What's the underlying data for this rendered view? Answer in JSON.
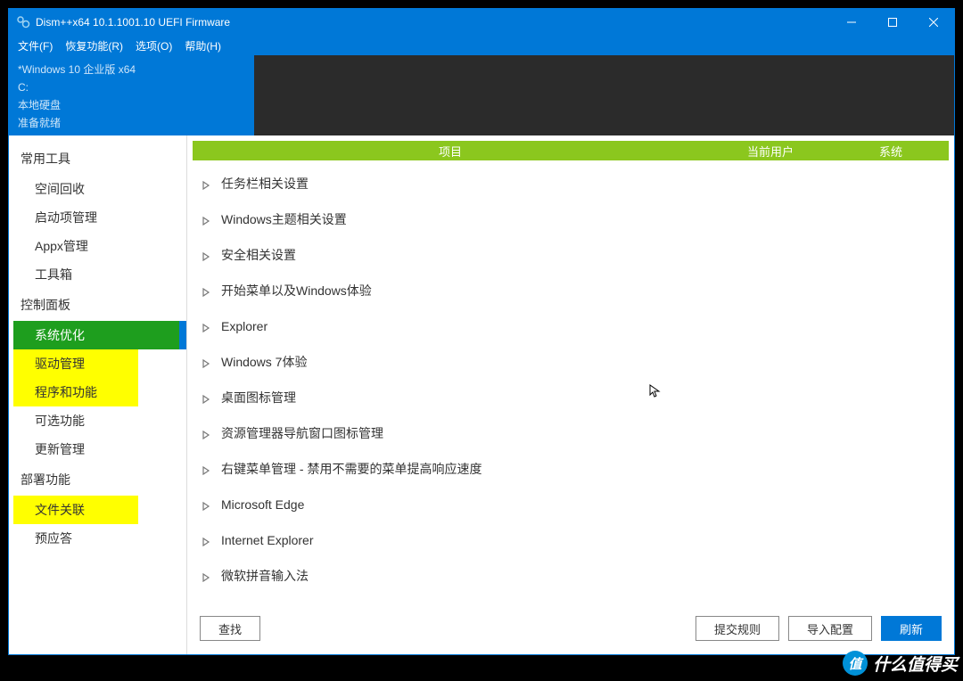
{
  "title": "Dism++x64 10.1.1001.10 UEFI Firmware",
  "menu": [
    "文件(F)",
    "恢复功能(R)",
    "选项(O)",
    "帮助(H)"
  ],
  "info": {
    "line1": "*Windows 10 企业版 x64",
    "line2": "C:",
    "line3": "本地硬盘",
    "line4": "准备就绪"
  },
  "sidebar": {
    "groups": [
      {
        "header": "常用工具",
        "items": [
          {
            "label": "空间回收"
          },
          {
            "label": "启动项管理"
          },
          {
            "label": "Appx管理"
          },
          {
            "label": "工具箱"
          }
        ]
      },
      {
        "header": "控制面板",
        "items": [
          {
            "label": "系统优化",
            "selected": true
          },
          {
            "label": "驱动管理",
            "hl": true
          },
          {
            "label": "程序和功能",
            "hl": true
          },
          {
            "label": "可选功能"
          },
          {
            "label": "更新管理"
          }
        ]
      },
      {
        "header": "部署功能",
        "items": [
          {
            "label": "文件关联",
            "hl": true
          },
          {
            "label": "预应答"
          }
        ]
      }
    ]
  },
  "columns": {
    "project": "项目",
    "user": "当前用户",
    "system": "系统"
  },
  "tree": [
    "任务栏相关设置",
    "Windows主题相关设置",
    "安全相关设置",
    "开始菜单以及Windows体验",
    "Explorer",
    "Windows 7体验",
    "桌面图标管理",
    "资源管理器导航窗口图标管理",
    "右键菜单管理 - 禁用不需要的菜单提高响应速度",
    "Microsoft Edge",
    "Internet Explorer",
    "微软拼音输入法"
  ],
  "footer": {
    "find": "查找",
    "submit": "提交规则",
    "import": "导入配置",
    "refresh": "刷新"
  },
  "watermark": {
    "badge": "值",
    "text": "什么值得买"
  }
}
